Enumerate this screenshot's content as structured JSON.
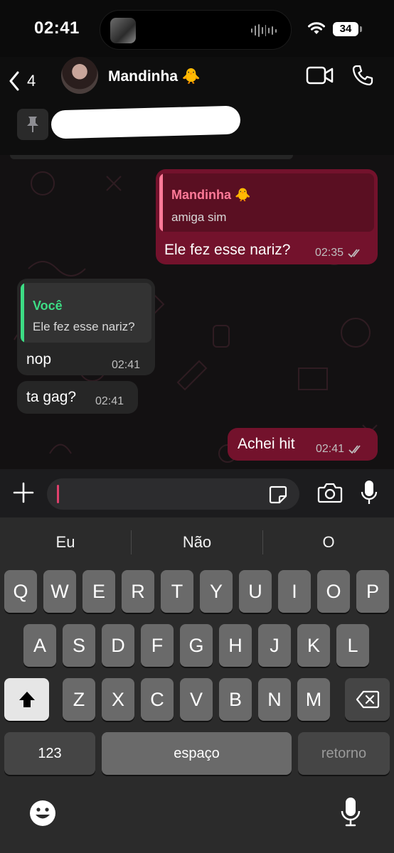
{
  "status_bar": {
    "time": "02:41",
    "battery": "34"
  },
  "header": {
    "back_count": "4",
    "contact_name": "Mandinha 🐥"
  },
  "messages": [
    {
      "direction": "outgoing",
      "quoted_name": "Mandinha 🐥",
      "quoted_text": "amiga sim",
      "text": "Ele fez esse nariz?",
      "time": "02:35",
      "status": "read"
    },
    {
      "direction": "incoming",
      "quoted_name": "Você",
      "quoted_text": "Ele fez esse nariz?",
      "text": "nop",
      "time": "02:41"
    },
    {
      "direction": "incoming",
      "text": "ta gag?",
      "time": "02:41"
    },
    {
      "direction": "outgoing",
      "text": "Achei hit",
      "time": "02:41",
      "status": "read"
    }
  ],
  "keyboard": {
    "suggestions": [
      "Eu",
      "Não",
      "O"
    ],
    "row1": [
      "Q",
      "W",
      "E",
      "R",
      "T",
      "Y",
      "U",
      "I",
      "O",
      "P"
    ],
    "row2": [
      "A",
      "S",
      "D",
      "F",
      "G",
      "H",
      "J",
      "K",
      "L"
    ],
    "row3": [
      "Z",
      "X",
      "C",
      "V",
      "B",
      "N",
      "M"
    ],
    "numbers_label": "123",
    "space_label": "espaço",
    "return_label": "retorno"
  },
  "colors": {
    "outgoing_bubble": "#73122c",
    "incoming_bubble": "#262626",
    "quote_outgoing_name": "#ff7a98",
    "quote_incoming_name": "#3ddc84",
    "caret": "#e0406c"
  },
  "icons": {
    "back": "chevron-left-icon",
    "video": "video-camera-icon",
    "call": "phone-icon",
    "pin": "pin-icon",
    "read": "double-check-icon",
    "plus": "plus-icon",
    "sticker": "sticker-icon",
    "camera": "camera-icon",
    "mic": "microphone-icon",
    "shift": "shift-arrow-icon",
    "backspace": "backspace-icon",
    "emoji": "emoji-icon",
    "dictation": "dictation-mic-icon"
  }
}
